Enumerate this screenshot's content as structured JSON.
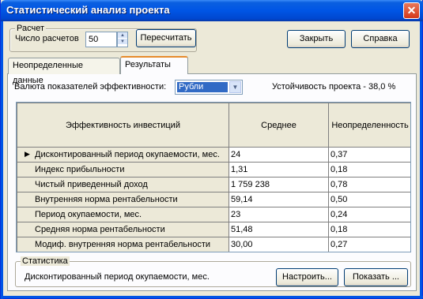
{
  "window": {
    "title": "Статистический анализ проекта",
    "close_glyph": "✕"
  },
  "calc": {
    "group_label": "Расчет",
    "count_label": "Число расчетов",
    "count_value": "50",
    "recalc_button": "Пересчитать"
  },
  "buttons": {
    "close": "Закрыть",
    "help": "Справка"
  },
  "tabs": [
    {
      "label": "Неопределенные данные",
      "active": false
    },
    {
      "label": "Результаты",
      "active": true
    }
  ],
  "currency": {
    "label": "Валюта показателей эффективности:",
    "value": "Рубли"
  },
  "stability": "Устойчивость проекта -  38,0 %",
  "table": {
    "headers": [
      "Эффективность инвестиций",
      "Среднее",
      "Неопределенность"
    ],
    "rows": [
      {
        "name": "Дисконтированный период окупаемости, мес.",
        "mean": "24",
        "uncertainty": "0,37",
        "selected": true
      },
      {
        "name": "Индекс прибыльности",
        "mean": "1,31",
        "uncertainty": "0,18"
      },
      {
        "name": "Чистый приведенный доход",
        "mean": "1 759 238",
        "uncertainty": "0,78"
      },
      {
        "name": "Внутренняя норма рентабельности",
        "mean": "59,14",
        "uncertainty": "0,50"
      },
      {
        "name": "Период окупаемости, мес.",
        "mean": "23",
        "uncertainty": "0,24"
      },
      {
        "name": "Средняя норма рентабельности",
        "mean": "51,48",
        "uncertainty": "0,18"
      },
      {
        "name": "Модиф. внутренняя норма рентабельности",
        "mean": "30,00",
        "uncertainty": "0,27"
      }
    ]
  },
  "statistics": {
    "group_label": "Статистика",
    "current": "Дисконтированный период окупаемости, мес.",
    "setup_button": "Настроить...",
    "show_button": "Показать ..."
  },
  "icons": {
    "row_marker": "triangle-right-icon",
    "spin_up": "chevron-up-icon",
    "spin_down": "chevron-down-icon",
    "combo": "chevron-down-icon"
  }
}
